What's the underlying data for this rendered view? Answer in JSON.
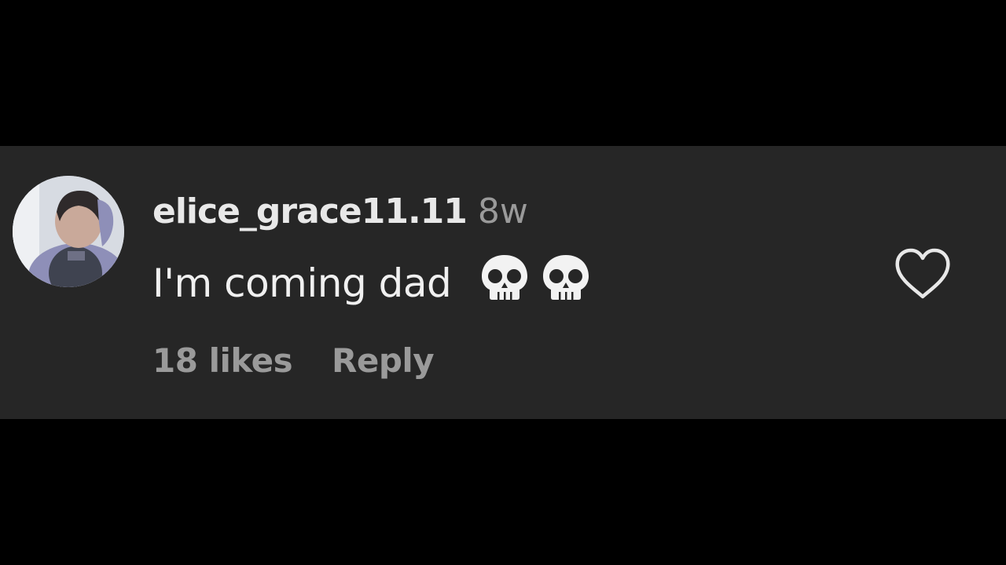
{
  "comment": {
    "username": "elice_grace11.11",
    "timestamp": "8w",
    "text": "I'm coming dad",
    "emojis": [
      "💀",
      "💀"
    ],
    "likes_label": "18 likes",
    "reply_label": "Reply"
  },
  "icons": {
    "like": "heart-outline-icon",
    "emoji": "skull-icon",
    "avatar": "profile-photo"
  },
  "colors": {
    "page_background": "#000000",
    "card_background": "#262626",
    "primary_text": "#f0f0f0",
    "secondary_text": "#9a9a9a"
  }
}
